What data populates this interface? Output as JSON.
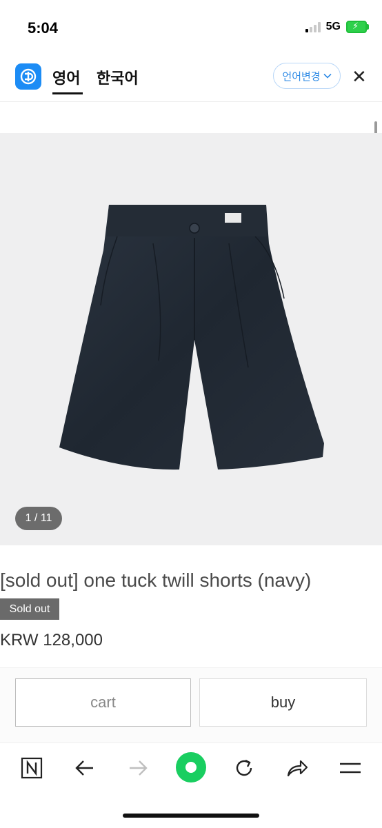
{
  "status_bar": {
    "time": "5:04",
    "network": "5G"
  },
  "translate_bar": {
    "tab_english": "영어",
    "tab_korean": "한국어",
    "change_language_label": "언어변경",
    "logo_icon": "papago-logo-icon",
    "close_icon": "close-icon"
  },
  "product": {
    "image_counter": "1 / 11",
    "title": "[sold out] one tuck twill shorts (navy)",
    "badge": "Sold out",
    "price": "KRW 128,000"
  },
  "actions": {
    "cart_label": "cart",
    "buy_label": "buy"
  },
  "browser_toolbar": {
    "icons": [
      "naver-home-icon",
      "back-arrow-icon",
      "forward-arrow-icon",
      "green-dot-icon",
      "refresh-icon",
      "share-icon",
      "menu-icon"
    ]
  },
  "colors": {
    "accent_blue": "#2f8be6",
    "logo_blue": "#1c8cf5",
    "green": "#19ce60",
    "navy": "#232b36"
  }
}
